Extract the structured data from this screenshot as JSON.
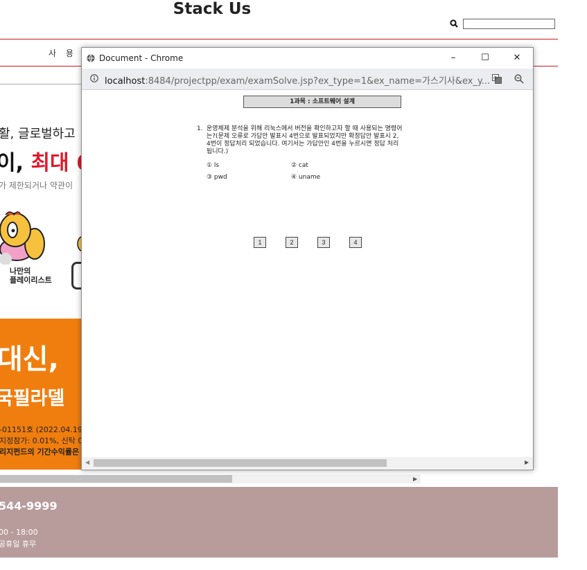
{
  "site": {
    "title": "Stack Us",
    "menu_label": "사 용 설",
    "search_placeholder": ""
  },
  "promo": {
    "line1": "활, 글로벌하고",
    "line2_black": "이, ",
    "line2_red": "최대 6",
    "line3": "가 제한되거나 약관이",
    "playlist_label": "나만의\n플레이리스트"
  },
  "banner": {
    "big": "대신,",
    "mid": "국필라델",
    "small1": "-01151호 (2022.04.19",
    "small2": "지정참가: 0.01%, 신탁 0.",
    "small3": "리지펀드의 기간수익률은"
  },
  "footer": {
    "phone": "544-9999",
    "hours": "00 - 18:00",
    "holiday": "공휴일 휴무"
  },
  "popup": {
    "window_title": "Document - Chrome",
    "url_host": "localhost",
    "url_rest": ":8484/projectpp/exam/examSolve.jsp?ex_type=1&ex_name=가스기사&ex_y...",
    "minimize": "–",
    "maximize": "☐",
    "close": "✕",
    "subject": "1과목 : 소프트웨어 설계",
    "question_number": "1.",
    "question_text": "운영체제 분석을 위해 리눅스에서 버전을 확인하고자 할 때 사용되는 명령어는?(문제 오류로 가답안 발표시 4번으로 발표되었지만 확정답안 발표시 2, 4번이 정답처리 되었습니다. 여기서는 가답안인 4번을 누르시면 정답 처리 됩니다.)",
    "choices": [
      "① ls",
      "② cat",
      "③ pwd",
      "④ uname"
    ],
    "answer_buttons": [
      "1",
      "2",
      "3",
      "4"
    ]
  },
  "colors": {
    "accent_red": "#c81b1b",
    "promo_red": "#e0192b",
    "banner_orange": "#f07e0e",
    "footer_bg": "#b89c9c"
  }
}
